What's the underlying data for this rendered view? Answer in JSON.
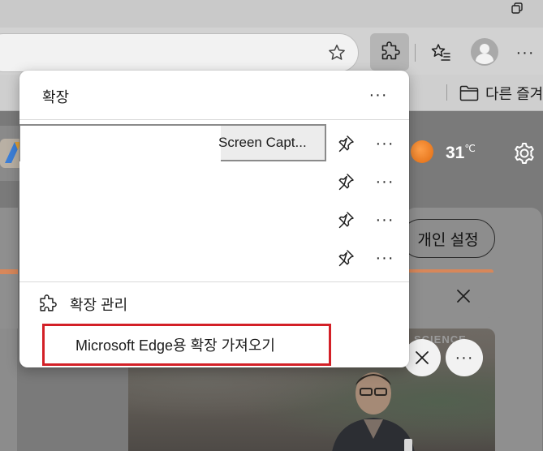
{
  "browser": {
    "favorites_bar": {
      "folder_label": "다른 즐겨"
    }
  },
  "page": {
    "weather": {
      "temp": "31",
      "unit": "℃"
    },
    "personalize_label": "개인 설정",
    "photo_tag": "SCIENCE"
  },
  "popup": {
    "title": "확장",
    "extensions": [
      {
        "name": "Screen Capt...",
        "pinned": false
      },
      {
        "name": "",
        "pinned": false
      },
      {
        "name": "",
        "pinned": false
      },
      {
        "name": "",
        "pinned": false
      }
    ],
    "manage_label": "확장 관리",
    "get_extensions_label": "Microsoft Edge용 확장 가져오기"
  },
  "colors": {
    "highlight_border": "#d32027",
    "popup_bg": "#ffffff",
    "overlay": "#7a7a7a"
  },
  "icons": {
    "extensions": "puzzle-icon",
    "favorites": "star-list-icon",
    "profile": "avatar-icon",
    "pin": "pin-icon",
    "folder": "folder-icon",
    "settings": "gear-icon",
    "close": "close-icon"
  }
}
